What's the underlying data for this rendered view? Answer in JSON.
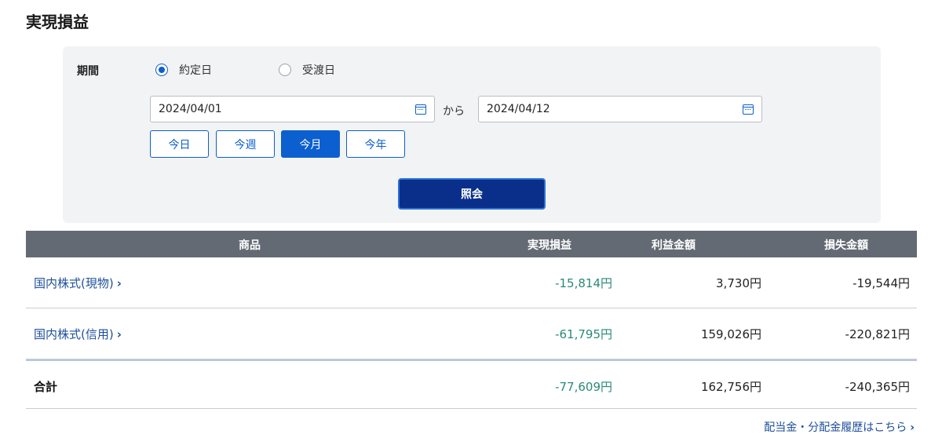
{
  "title": "実現損益",
  "filter": {
    "period_label": "期間",
    "radios": [
      {
        "label": "約定日",
        "checked": true
      },
      {
        "label": "受渡日",
        "checked": false
      }
    ],
    "date_from": "2024/04/01",
    "date_to": "2024/04/12",
    "kara": "から",
    "quick_buttons": [
      {
        "label": "今日",
        "active": false
      },
      {
        "label": "今週",
        "active": false
      },
      {
        "label": "今月",
        "active": true
      },
      {
        "label": "今年",
        "active": false
      }
    ],
    "query_button": "照会",
    "icons": [
      "calendar-icon"
    ]
  },
  "table": {
    "headers": {
      "product": "商品",
      "realized": "実現損益",
      "profit": "利益金額",
      "loss": "損失金額"
    },
    "rows": [
      {
        "product": "国内株式(現物)",
        "chevron": "›",
        "realized": "-15,814円",
        "profit": "3,730円",
        "loss": "-19,544円"
      },
      {
        "product": "国内株式(信用)",
        "chevron": "›",
        "realized": "-61,795円",
        "profit": "159,026円",
        "loss": "-220,821円"
      }
    ],
    "total": {
      "label": "合計",
      "realized": "-77,609円",
      "profit": "162,756円",
      "loss": "-240,365円"
    }
  },
  "history_link": {
    "label": "配当金・分配金履歴はこちら",
    "chevron": "›"
  },
  "colors": {
    "accent": "#0b5fcf",
    "query_button": "#0a2f8a",
    "header_bg": "#646a73",
    "panel_bg": "#f2f3f5",
    "negative_green": "#2a8a78",
    "link": "#1e4f9a"
  }
}
